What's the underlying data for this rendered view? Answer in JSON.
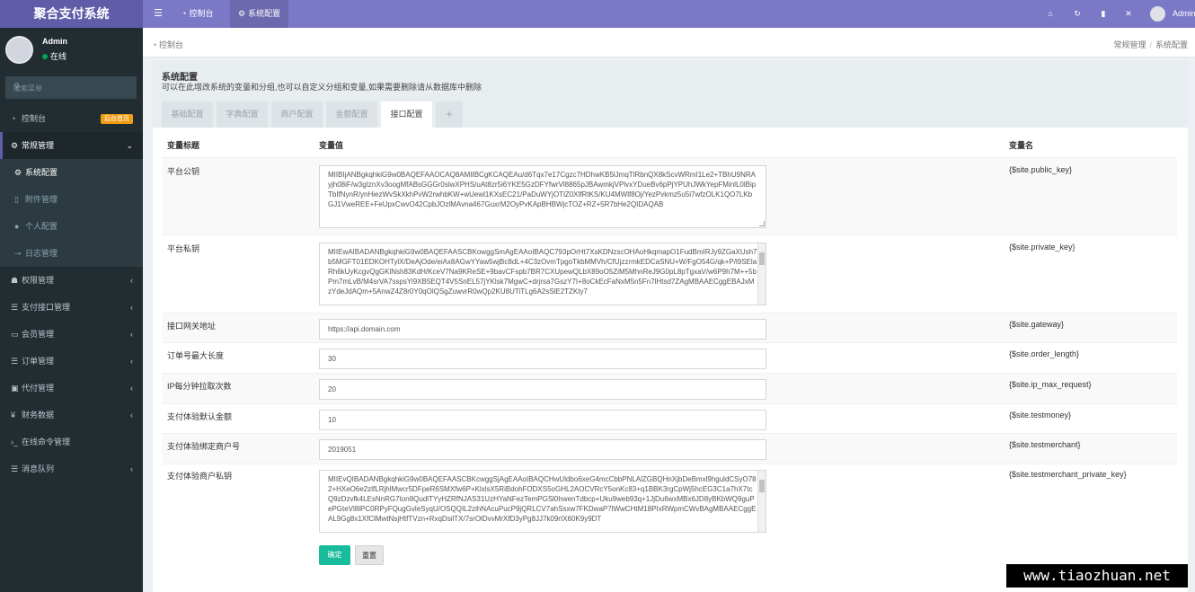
{
  "app": {
    "title": "聚合支付系统"
  },
  "topbar": {
    "toggle_icon": "☰",
    "nav": [
      {
        "label": "控制台",
        "icon": "dashboard-icon"
      },
      {
        "label": "系统配置",
        "icon": "gear-icon"
      }
    ],
    "icons": [
      "home-icon",
      "refresh-icon",
      "trash-icon",
      "fullscreen-icon"
    ],
    "user": "Admin"
  },
  "sidebar": {
    "user": {
      "name": "Admin",
      "status": "在线"
    },
    "search_placeholder": "搜索菜单",
    "menu": [
      {
        "label": "控制台",
        "icon": "dashboard-icon",
        "badge": "后台首页"
      },
      {
        "label": "常规管理",
        "icon": "cogs-icon",
        "arrow": "⌄"
      },
      {
        "label": "系统配置",
        "icon": "gear-icon"
      },
      {
        "label": "附件管理",
        "icon": "file-icon"
      },
      {
        "label": "个人配置",
        "icon": "user-icon"
      },
      {
        "label": "日志管理",
        "icon": "log-icon"
      },
      {
        "label": "权限管理",
        "icon": "group-icon",
        "arrow": "‹"
      },
      {
        "label": "支付接口管理",
        "icon": "list-icon",
        "arrow": "‹"
      },
      {
        "label": "会员管理",
        "icon": "card-icon",
        "arrow": "‹"
      },
      {
        "label": "订单管理",
        "icon": "list-icon",
        "arrow": "‹"
      },
      {
        "label": "代付管理",
        "icon": "money-icon",
        "arrow": "‹"
      },
      {
        "label": "财务数据",
        "icon": "yen-icon",
        "arrow": "‹"
      },
      {
        "label": "在线命令管理",
        "icon": "terminal-icon"
      },
      {
        "label": "消息队列",
        "icon": "list-icon",
        "arrow": "‹"
      }
    ]
  },
  "breadcrumb": {
    "home": "控制台",
    "trail": [
      "常规管理",
      "系统配置"
    ]
  },
  "panel": {
    "title": "系统配置",
    "desc": "可以在此增改系统的变量和分组,也可以自定义分组和变量,如果需要删除请从数据库中删除",
    "tabs": [
      "基础配置",
      "字典配置",
      "商户配置",
      "金额配置",
      "接口配置",
      "+"
    ],
    "headers": {
      "label": "变量标题",
      "value": "变量值",
      "name": "变量名"
    },
    "rows": [
      {
        "label": "平台公钥",
        "var": "{$site.public_key}",
        "value": "MIIBIjANBgkqhkiG9w0BAQEFAAOCAQ8AMIIBCgKCAQEAu/d6Tqx7e17Cgzc7HDhwKB5lJmqTlRbnQX8kScvWRmI1Le2+TBhU9NRAyjh08iF/w3gIznXv3oogMfABsGGGr0slwXPHS/uAt8zr5i6YKE5GzDFYfwrVl8865pJBAwmkjVPlvxYDueBv6pPjYPUhJWkYepFMinlL0lBipTbIfNynR/ynHiezWvSkXkhPvW2rwhbKW+wUewl1KXsEC21/PaDuWYjOTlZ0XlfRtKS/KU4MWlf8Oj/YezPvkmz5u5i7wfzOLK1QO7LKbGJ1VweREE+FeUpxCwvO42CpbJOzlMAvna467GuxrM2OyPvKApBHBWjcTOZ+RZ+5R7bHe2QIDAQAB"
      },
      {
        "label": "平台私钥",
        "var": "{$site.private_key}",
        "value": "MIIEwAIBADANBgkqhkiG9w0BAQEFAASCBKowggSmAgEAAoIBAQC793pOrHt7XsKDNzscOHAoHkqmapO1FudBmIRJy9ZGaXUsh7b5MGFT01EDKOHTylX/DeAjOde/eiAx8AGwYYaw5wjBc8dL+4C3zOvmTpgoTkbMMVh/CfUjzzrmkEDCaSNU+W/FgO54G/qk+P/l9SElaRh6kUyKcgvQgGKlNsh83KdH/KceV7Na9KReSE+9bavCFspb7BR7CXUpewQLbX89oO5ZiM5MhnReJ9G0pL8pTgxaV/w6P9h7M++5bPm7mLvB/M4srVA7sspsYi9XB5EQT4V5SnEL57jYKlsk7MgwC+drjrsa7GszY7I+8oCkEcFaNxM5n5Fn7lHtsd7ZAgMBAAECggEBAJxMzYdeJdAQm+5AnwZ4Z8r0Y0qOlQSgZuwvrR0wQp2KU8UTiTLg6A2sSlE2TZKty7"
      },
      {
        "label": "接口网关地址",
        "var": "{$site.gateway}",
        "value": "https://api.domain.com"
      },
      {
        "label": "订单号最大长度",
        "var": "{$site.order_length}",
        "value": "30"
      },
      {
        "label": "IP每分钟拉取次数",
        "var": "{$site.ip_max_request}",
        "value": "20"
      },
      {
        "label": "支付体验默认金额",
        "var": "{$site.testmoney}",
        "value": "10"
      },
      {
        "label": "支付体验绑定商户号",
        "var": "{$site.testmerchant}",
        "value": "2019051"
      },
      {
        "label": "支付体验商户私钥",
        "var": "{$site.testmerchant_private_key}",
        "value": "MIIEvQIBADANBgkqhkiG9w0BAQEFAASCBKcwggSjAgEAAoIBAQCHwUldbo6xeG4mcCbbPNLAlZGBQHnXjbDeBmxl9hguldCSyO782+HXeO6e2zlfLRjhlMwcr5DFpeR6SMXfw6P+KlxlsX5RiBdohFODXS5oGHL2AOCVRcY5onKc83+q1BBK3rgCpWj5hcEG3C1a7hX7tcQ9zDzvfk4LEsNnRG7ton8QudlTYyHZRfNJAS31UzHYaNFezTemPGSl0hwenTdbcp+Uku9web93q+1JjDu6wxMBx6JD8yBKbWQ9guPePGteVl8lPC0RPyFQugGvleSyqU/OSQQIL2zihNAcuPucP9jQRLCV7ahSsxw7FKDwaP7lWwCHtM18PIxRWpmCWvBAgMBAAECggEAL9Gg8x1XfClMwtNsjHtfTVzn+RxqDsilTX/7srOlDvvMrXfD3yPg8JJ7k09rIX60K9y9DT"
      }
    ],
    "buttons": {
      "ok": "确定",
      "reset": "重置"
    }
  },
  "watermark": "www.tiaozhuan.net"
}
